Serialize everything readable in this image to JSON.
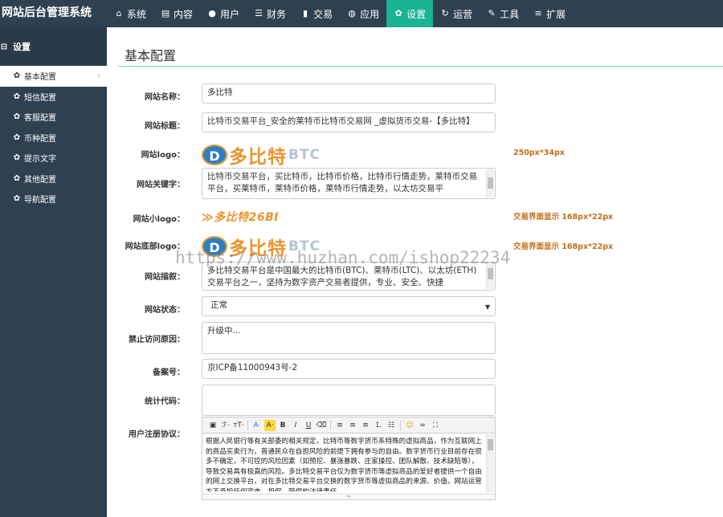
{
  "app": {
    "title": "网站后台管理系统"
  },
  "nav": [
    {
      "label": "系统",
      "icon": "home-icon",
      "glyph": "⌂"
    },
    {
      "label": "内容",
      "icon": "document-icon",
      "glyph": "▤"
    },
    {
      "label": "用户",
      "icon": "user-icon",
      "glyph": "●"
    },
    {
      "label": "财务",
      "icon": "list-icon",
      "glyph": "☰"
    },
    {
      "label": "交易",
      "icon": "bar-chart-icon",
      "glyph": "▮"
    },
    {
      "label": "应用",
      "icon": "globe-icon",
      "glyph": "◍"
    },
    {
      "label": "设置",
      "icon": "gear-icon",
      "glyph": "✿"
    },
    {
      "label": "运营",
      "icon": "refresh-icon",
      "glyph": "↻"
    },
    {
      "label": "工具",
      "icon": "wrench-icon",
      "glyph": "✎"
    },
    {
      "label": "扩展",
      "icon": "server-icon",
      "glyph": "≡"
    }
  ],
  "nav_active_index": 6,
  "sidebar": {
    "heading": "设置",
    "items": [
      {
        "label": "基本配置"
      },
      {
        "label": "短信配置"
      },
      {
        "label": "客服配置"
      },
      {
        "label": "币种配置"
      },
      {
        "label": "提示文字"
      },
      {
        "label": "其他配置"
      },
      {
        "label": "导航配置"
      }
    ]
  },
  "main": {
    "title": "基本配置",
    "fields": {
      "site_name": {
        "label": "网站名称：",
        "value": "多比特"
      },
      "site_title": {
        "label": "网站标题：",
        "value": "比特币交易平台_安全的莱特币比特币交易网 _虚拟货币交易-【多比特】"
      },
      "site_logo": {
        "label": "网站logo：",
        "note": "250px*34px",
        "mark": "D",
        "text": "多比特",
        "sub": "BTC"
      },
      "keywords": {
        "label": "网站关键字：",
        "value": "比特币交易平台，买比特币，比特币价格，比特币行情走势，莱特币交易平台，买莱特币，莱特币价格，莱特币行情走势，以太坊交易平"
      },
      "small_logo": {
        "label": "网站小logo：",
        "note": "交易界面显示 168px*22px",
        "text": "≫多比特26BI"
      },
      "footer_logo": {
        "label": "网站底部logo：",
        "note": "交易界面显示 168px*22px",
        "mark": "D",
        "text": "多比特",
        "sub": "BTC"
      },
      "description": {
        "label": "网站描叙：",
        "value": "多比特交易平台是中国最大的比特币(BTC)、莱特币(LTC)、以太坊(ETH)交易平台之一，坚持为数字资产交易者提供，专业、安全、快捷"
      },
      "status": {
        "label": "网站状态：",
        "value": "正常"
      },
      "forbid_reason": {
        "label": "禁止访问原因：",
        "value": "升级中..."
      },
      "icp": {
        "label": "备案号：",
        "value": "京ICP备11000943号-2"
      },
      "stats_code": {
        "label": "统计代码：",
        "value": ""
      },
      "agreement": {
        "label": "用户注册协议：",
        "value": "根据人民银行等有关部委的相关规定，比特币等数字货币系特殊的虚拟商品，作为互联网上的商品买卖行为，普通民众在自担风险的前提下拥有参与的自由。数字货币行业目前存在很多不确定，不可控的风险因素（如预挖、暴涨暴跌、庄家操控、团队解散、技术缺陷等），导致交易具有极高的风险。多比特交易平台仅为数字货币等虚拟商品的爱好者提供一个自由的网上交换平台，对在多比特交易平台交换的数字货币等虚拟商品的来源、价值，网站运营方不承担任何审查、担保、赔偿的法律责任。"
      }
    }
  },
  "editor_toolbar": [
    {
      "name": "source-icon",
      "glyph": "▣"
    },
    {
      "name": "font-family-icon",
      "glyph": "ℱ·"
    },
    {
      "name": "font-size-icon",
      "glyph": "тT·"
    },
    {
      "name": "font-color-icon",
      "glyph": "A·"
    },
    {
      "name": "highlight-icon",
      "glyph": "A·"
    },
    {
      "name": "bold-icon",
      "glyph": "B"
    },
    {
      "name": "italic-icon",
      "glyph": "I"
    },
    {
      "name": "underline-icon",
      "glyph": "U"
    },
    {
      "name": "eraser-icon",
      "glyph": "⌫"
    },
    {
      "name": "align-left-icon",
      "glyph": "≡"
    },
    {
      "name": "align-center-icon",
      "glyph": "≡"
    },
    {
      "name": "align-right-icon",
      "glyph": "≡"
    },
    {
      "name": "ordered-list-icon",
      "glyph": "⒈"
    },
    {
      "name": "unordered-list-icon",
      "glyph": "☷"
    },
    {
      "name": "emoticon-icon",
      "glyph": "☺"
    },
    {
      "name": "link-icon",
      "glyph": "∞"
    },
    {
      "name": "fullscreen-icon",
      "glyph": "⛶"
    }
  ],
  "watermark": "https://www.huzhan.com/ishop22234",
  "colors": {
    "sidebar": "#2f4050",
    "accent": "#1ab394",
    "note": "#c0701c"
  }
}
